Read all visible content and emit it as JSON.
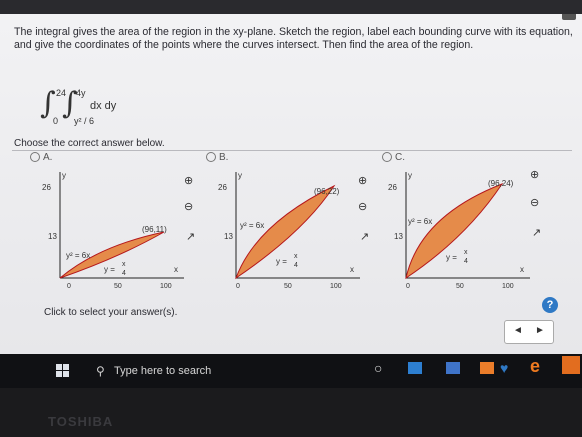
{
  "question": {
    "text": "The integral gives the area of the region in the xy-plane. Sketch the region, label each bounding curve with its equation, and give the coordinates of the points where the curves intersect. Then find the area of the region."
  },
  "integral": {
    "outer_lower": "0",
    "outer_upper": "24",
    "inner_lower": "y² / 6",
    "inner_upper": "4y",
    "integrand": "dx dy"
  },
  "choose_label": "Choose the correct answer below.",
  "options": [
    {
      "letter": "A.",
      "point_label": "(96,11)",
      "curve_upper": "y² = 6x",
      "curve_lower_num": "x",
      "curve_lower_den": "4",
      "curve_lower_prefix": "y =",
      "ytick_high": "26",
      "ytick_mid": "13",
      "xtick_mid": "50",
      "xtick_high": "100",
      "origin": "0",
      "x_axis": "x",
      "y_axis": "y"
    },
    {
      "letter": "B.",
      "point_label": "(96,22)",
      "curve_upper": "y² = 6x",
      "curve_lower_num": "x",
      "curve_lower_den": "4",
      "curve_lower_prefix": "y =",
      "ytick_high": "26",
      "ytick_mid": "13",
      "xtick_mid": "50",
      "xtick_high": "100",
      "origin": "0",
      "x_axis": "x",
      "y_axis": "y"
    },
    {
      "letter": "C.",
      "point_label": "(96,24)",
      "curve_upper": "y² = 6x",
      "curve_lower_num": "x",
      "curve_lower_den": "4",
      "curve_lower_prefix": "y =",
      "ytick_high": "26",
      "ytick_mid": "13",
      "xtick_mid": "50",
      "xtick_high": "100",
      "origin": "0",
      "x_axis": "x",
      "y_axis": "y"
    }
  ],
  "click_note": "Click to select your answer(s).",
  "help_label": "?",
  "nav": {
    "prev": "◄",
    "next": "►"
  },
  "taskbar": {
    "search_placeholder": "Type here to search"
  },
  "brand": "TOSHIBA",
  "colors": {
    "region_fill": "#e58b4a",
    "curve_stroke": "#b5181c",
    "help_blue": "#2f79c5",
    "taskbar": "#101114"
  },
  "icons": [
    "zoom-in-icon",
    "zoom-out-icon",
    "popout-icon",
    "windows-logo-icon",
    "search-icon",
    "cortana-icon",
    "edge-icon"
  ]
}
